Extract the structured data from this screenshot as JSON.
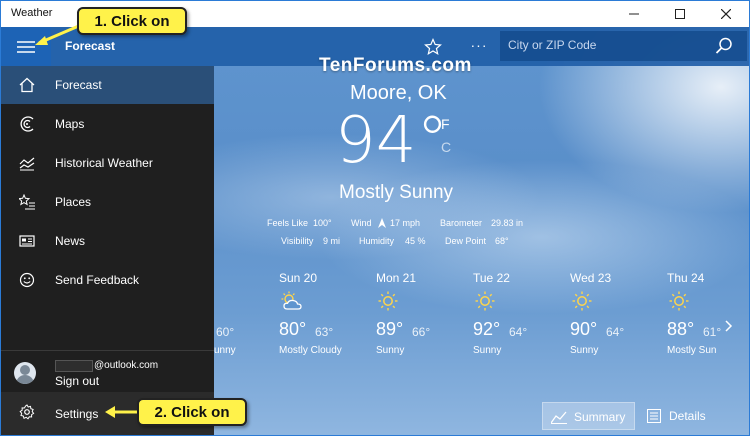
{
  "window": {
    "title": "Weather",
    "minimize_icon": "minimize-icon",
    "maximize_icon": "maximize-icon",
    "close_icon": "close-icon"
  },
  "header": {
    "title": "Forecast",
    "favorite_icon": "star-icon",
    "more_label": "···",
    "search_placeholder": "City or ZIP Code"
  },
  "nav": {
    "items": [
      {
        "label": "Forecast",
        "icon": "home-icon"
      },
      {
        "label": "Maps",
        "icon": "maps-icon"
      },
      {
        "label": "Historical Weather",
        "icon": "historical-chart-icon"
      },
      {
        "label": "Places",
        "icon": "places-star-list-icon"
      },
      {
        "label": "News",
        "icon": "news-icon"
      },
      {
        "label": "Send Feedback",
        "icon": "smiley-icon"
      }
    ],
    "account_email": "@outlook.com",
    "sign_out": "Sign out",
    "settings": "Settings"
  },
  "watermark": "TenForums.com",
  "current": {
    "location": "Moore, OK",
    "temperature": "94°",
    "unit_f": "F",
    "unit_c": "C",
    "condition": "Mostly Sunny",
    "details": {
      "feels_like_label": "Feels Like",
      "feels_like_value": "100°",
      "wind_label": "Wind",
      "wind_value": "17 mph",
      "barometer_label": "Barometer",
      "barometer_value": "29.83 in",
      "visibility_label": "Visibility",
      "visibility_value": "9 mi",
      "humidity_label": "Humidity",
      "humidity_value": "45 %",
      "dew_point_label": "Dew Point",
      "dew_point_value": "68°"
    }
  },
  "forecast": {
    "partial_day": {
      "low": "60°",
      "condition": "unny"
    },
    "days": [
      {
        "name": "Sun 20",
        "icon": "partly-cloudy-icon",
        "high": "80°",
        "low": "63°",
        "condition": "Mostly Cloudy"
      },
      {
        "name": "Mon 21",
        "icon": "sun-icon",
        "high": "89°",
        "low": "66°",
        "condition": "Sunny"
      },
      {
        "name": "Tue 22",
        "icon": "sun-icon",
        "high": "92°",
        "low": "64°",
        "condition": "Sunny"
      },
      {
        "name": "Wed 23",
        "icon": "sun-icon",
        "high": "90°",
        "low": "64°",
        "condition": "Sunny"
      },
      {
        "name": "Thu 24",
        "icon": "sun-icon",
        "high": "88°",
        "low": "61°",
        "condition": "Mostly Sun"
      }
    ]
  },
  "tabs": {
    "summary": "Summary",
    "details": "Details"
  },
  "callouts": {
    "first": "1. Click on",
    "second": "2. Click on"
  },
  "colors": {
    "accent": "#1d63b5",
    "nav_bg": "#1f1f1f",
    "nav_active": "#2a4f78",
    "callout": "#fff24a"
  }
}
